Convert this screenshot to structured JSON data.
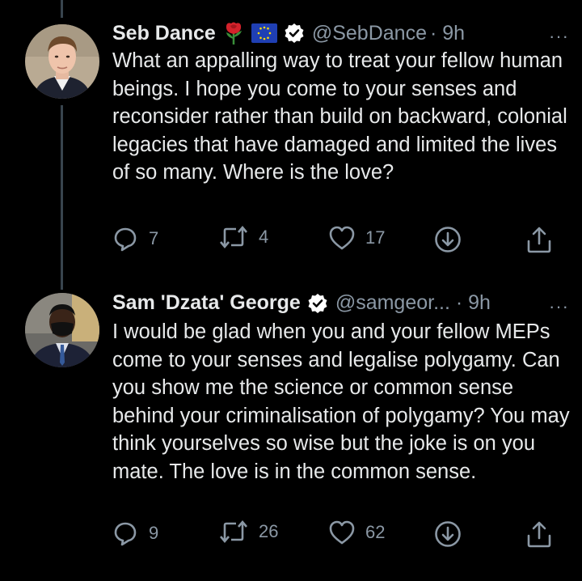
{
  "tweets": [
    {
      "name": "Seb Dance",
      "handle": "@SebDance",
      "time": "· 9h",
      "text": "What an appalling way to treat your fellow human beings. I hope you come to your senses and reconsider rather than build on backward, colonial legacies that have damaged and limited the lives of so many. Where is the love?",
      "replies": "7",
      "retweets": "4",
      "likes": "17"
    },
    {
      "name": "Sam 'Dzata' George",
      "handle": "@samgeor... · 9h",
      "time": "",
      "text": "I would be glad when you and your fellow MEPs come to your senses and legalise polygamy. Can you show me the science or common sense behind your criminalisation of polygamy? You may think yourselves so wise but the joke is on you mate. The love is in the common sense.",
      "replies": "9",
      "retweets": "26",
      "likes": "62"
    }
  ],
  "more_label": "···",
  "colors": {
    "background": "#000000",
    "text": "#e7e9ea",
    "muted": "#8b98a5",
    "verified": "#ffffff"
  }
}
